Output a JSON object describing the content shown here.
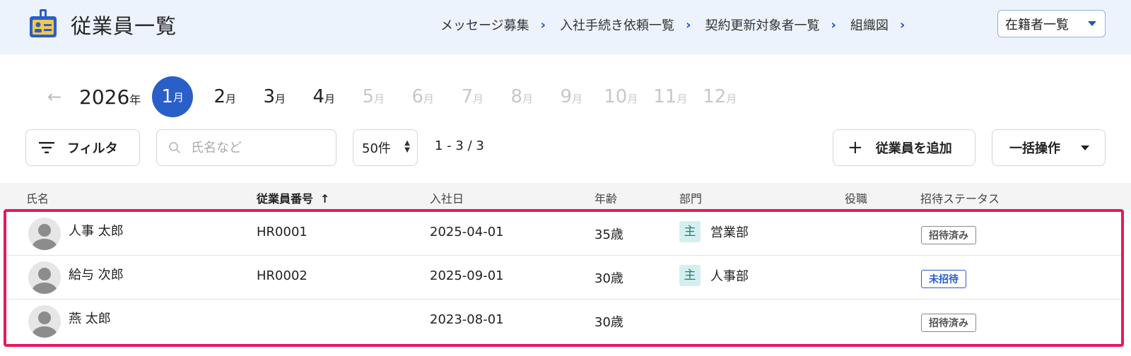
{
  "header": {
    "title": "従業員一覧",
    "nav": [
      {
        "label": "メッセージ募集"
      },
      {
        "label": "入社手続き依頼一覧"
      },
      {
        "label": "契約更新対象者一覧"
      },
      {
        "label": "組織図"
      }
    ],
    "status_filter": "在籍者一覧"
  },
  "month_picker": {
    "year": "2026",
    "year_suffix": "年",
    "month_suffix": "月",
    "months": [
      "1",
      "2",
      "3",
      "4",
      "5",
      "6",
      "7",
      "8",
      "9",
      "10",
      "11",
      "12"
    ],
    "active_month": "1",
    "enabled_through": "4"
  },
  "toolbar": {
    "filter_label": "フィルタ",
    "search_placeholder": "氏名など",
    "page_size": "50件",
    "range": "1 - 3 / 3",
    "add_label": "従業員を追加",
    "bulk_label": "一括操作"
  },
  "table": {
    "columns": {
      "name": "氏名",
      "employee_no": "従業員番号",
      "hire_date": "入社日",
      "age": "年齢",
      "department": "部門",
      "position": "役職",
      "invite_status": "招待ステータス"
    },
    "sort_arrow": "↑",
    "rows": [
      {
        "name": "人事 太郎",
        "employee_no": "HR0001",
        "hire_date": "2025-04-01",
        "age": "35歳",
        "dept_tag": "主",
        "department": "営業部",
        "position": "",
        "invite_status": "招待済み"
      },
      {
        "name": "給与 次郎",
        "employee_no": "HR0002",
        "hire_date": "2025-09-01",
        "age": "30歳",
        "dept_tag": "主",
        "department": "人事部",
        "position": "",
        "invite_status": "未招待"
      },
      {
        "name": "燕 太郎",
        "employee_no": "",
        "hire_date": "2023-08-01",
        "age": "30歳",
        "dept_tag": "",
        "department": "",
        "position": "",
        "invite_status": "招待済み"
      }
    ]
  },
  "colors": {
    "header_bg": "#ecf3fc",
    "accent": "#2a5fc8",
    "highlight_border": "#e8195a",
    "dept_tag_bg": "#d4efef"
  }
}
